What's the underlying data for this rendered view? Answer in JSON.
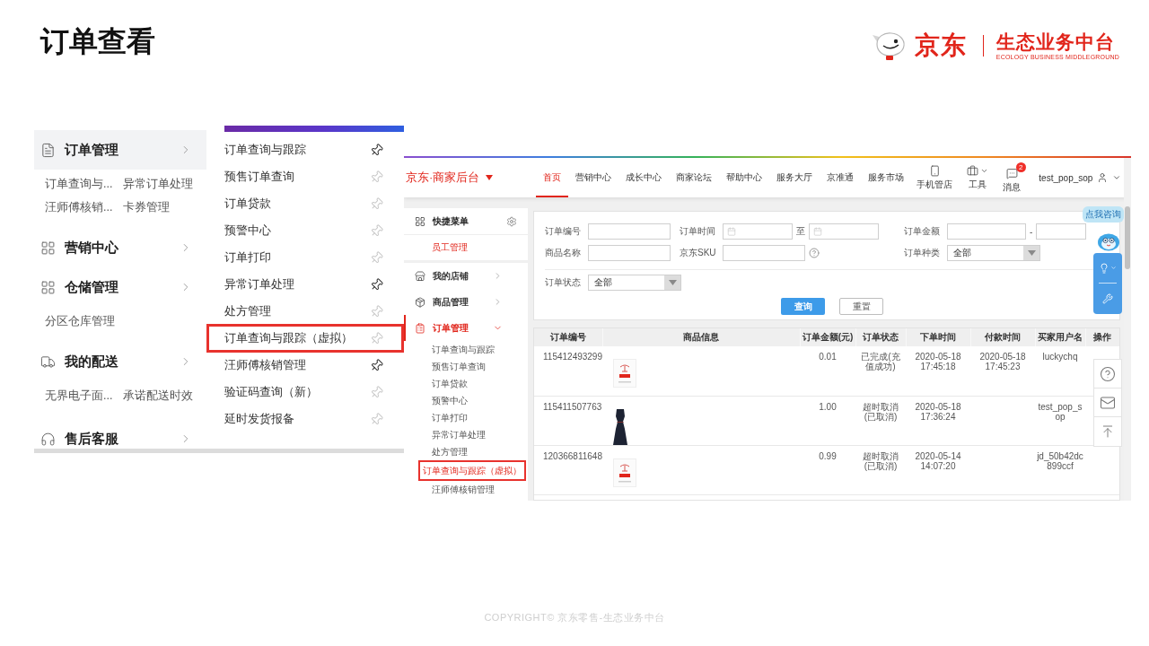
{
  "slide": {
    "title": "订单查看",
    "logo": {
      "brand": "京东",
      "product": "生态业务中台",
      "tagline": "ECOLOGY BUSINESS MIDDLEGROUND"
    },
    "footer": "COPYRIGHT© 京东零售-生态业务中台"
  },
  "menu_panel": {
    "categories": [
      {
        "label": "订单管理",
        "kind": "document",
        "selected": true,
        "links": [
          "订单查询与...",
          "异常订单处理",
          "汪师傅核销...",
          "卡券管理"
        ]
      },
      {
        "label": "营销中心",
        "kind": "grid",
        "selected": false
      },
      {
        "label": "仓储管理",
        "kind": "grid",
        "selected": false,
        "links": [
          "分区仓库管理"
        ]
      },
      {
        "label": "我的配送",
        "kind": "truck",
        "selected": false,
        "links": [
          "无界电子面...",
          "承诺配送时效"
        ]
      },
      {
        "label": "售后客服",
        "kind": "headset",
        "selected": false
      }
    ],
    "submenu": [
      {
        "label": "订单查询与跟踪",
        "pinned": true,
        "highlighted": false
      },
      {
        "label": "预售订单查询",
        "pinned": false,
        "highlighted": false
      },
      {
        "label": "订单贷款",
        "pinned": false,
        "highlighted": false
      },
      {
        "label": "预警中心",
        "pinned": false,
        "highlighted": false
      },
      {
        "label": "订单打印",
        "pinned": false,
        "highlighted": false
      },
      {
        "label": "异常订单处理",
        "pinned": true,
        "highlighted": false
      },
      {
        "label": "处方管理",
        "pinned": false,
        "highlighted": false
      },
      {
        "label": "订单查询与跟踪（虚拟）",
        "pinned": false,
        "highlighted": true
      },
      {
        "label": "汪师傅核销管理",
        "pinned": true,
        "highlighted": false
      },
      {
        "label": "验证码查询（新）",
        "pinned": false,
        "highlighted": false
      },
      {
        "label": "延时发货报备",
        "pinned": false,
        "highlighted": false
      }
    ]
  },
  "backend": {
    "brand": "京东·商家后台",
    "nav": [
      {
        "label": "首页",
        "selected": true
      },
      {
        "label": "营销中心",
        "selected": false
      },
      {
        "label": "成长中心",
        "selected": false
      },
      {
        "label": "商家论坛",
        "selected": false
      },
      {
        "label": "帮助中心",
        "selected": false
      },
      {
        "label": "服务大厅",
        "selected": false
      },
      {
        "label": "京准通",
        "selected": false
      },
      {
        "label": "服务市场",
        "selected": false
      }
    ],
    "tools": [
      {
        "kind": "phone",
        "label": "手机管店"
      },
      {
        "kind": "toolbox",
        "label": "工具"
      },
      {
        "kind": "chat",
        "label": "消息",
        "badge": "2"
      }
    ],
    "user": "test_pop_sop",
    "sidebar": {
      "quick_menu": {
        "title": "快捷菜单",
        "items": [
          "员工管理"
        ]
      },
      "groups": [
        {
          "label": "我的店铺",
          "kind": "store",
          "expanded": false
        },
        {
          "label": "商品管理",
          "kind": "goods",
          "expanded": false
        },
        {
          "label": "订单管理",
          "kind": "orders",
          "expanded": true,
          "children": [
            {
              "label": "订单查询与跟踪",
              "selected": false,
              "highlighted": false
            },
            {
              "label": "预售订单查询",
              "selected": false,
              "highlighted": false
            },
            {
              "label": "订单贷款",
              "selected": false,
              "highlighted": false
            },
            {
              "label": "预警中心",
              "selected": false,
              "highlighted": false
            },
            {
              "label": "订单打印",
              "selected": false,
              "highlighted": false
            },
            {
              "label": "异常订单处理",
              "selected": false,
              "highlighted": false
            },
            {
              "label": "处方管理",
              "selected": false,
              "highlighted": false
            },
            {
              "label": "订单查询与跟踪（虚拟）",
              "selected": true,
              "highlighted": true
            },
            {
              "label": "汪师傅核销管理",
              "selected": false,
              "highlighted": false
            }
          ]
        }
      ]
    },
    "filter_form": {
      "rows": [
        [
          {
            "label": "订单编号",
            "kind": "text"
          },
          {
            "label": "订单时间",
            "kind": "daterange",
            "separator": "至"
          },
          {
            "label": "订单金额",
            "kind": "range",
            "separator": "-"
          }
        ],
        [
          {
            "label": "商品名称",
            "kind": "text"
          },
          {
            "label": "京东SKU",
            "kind": "help"
          },
          {
            "label": "订单种类",
            "kind": "select",
            "value": "全部"
          }
        ],
        [
          {
            "label": "订单状态",
            "kind": "select",
            "value": "全部"
          }
        ]
      ],
      "buttons": [
        {
          "label": "查询",
          "kind": "primary"
        },
        {
          "label": "重置",
          "kind": "secondary"
        }
      ]
    },
    "orders_table": {
      "columns": [
        "订单编号",
        "商品信息",
        "订单金额(元)",
        "订单状态",
        "下单时间",
        "付款时间",
        "买家用户名",
        "操作"
      ],
      "rows": [
        {
          "order_no": "115412493299",
          "kind": "logo",
          "amount": "0.01",
          "status": "已完成(充值成功)",
          "ordered_at": "2020-05-18 17:45:18",
          "paid_at": "2020-05-18 17:45:23",
          "buyer": "luckychq"
        },
        {
          "order_no": "115411507763",
          "kind": "dress",
          "amount": "1.00",
          "status": "超时取消(已取消)",
          "ordered_at": "2020-05-18 17:36:24",
          "buyer": "test_pop_sop"
        },
        {
          "order_no": "120366811648",
          "kind": "logo",
          "amount": "0.99",
          "status": "超时取消(已取消)",
          "ordered_at": "2020-05-14 14:07:20",
          "buyer": "jd_50b42dc899ccf"
        }
      ]
    },
    "support": {
      "bubble": "点我咨询"
    }
  }
}
